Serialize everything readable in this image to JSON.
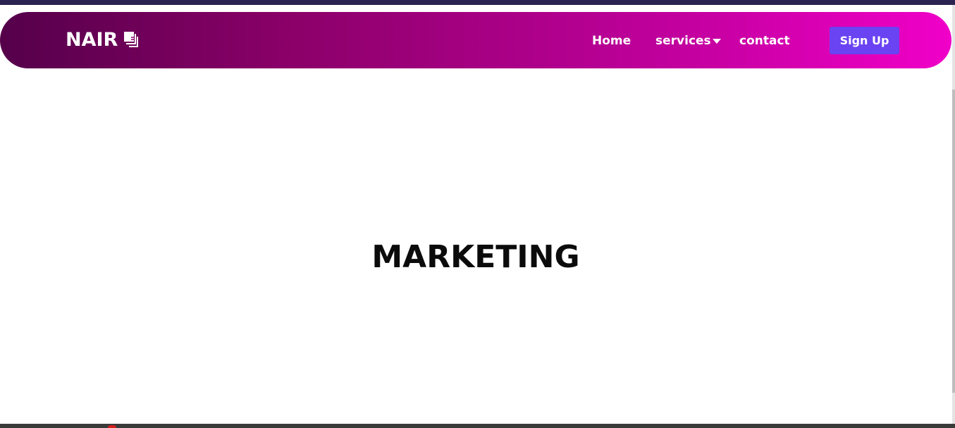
{
  "brand": {
    "name": "NAIR",
    "icon": "stacked-squares-logo-icon"
  },
  "nav": {
    "items": [
      {
        "label": "Home"
      },
      {
        "label": "services",
        "icon": "caret-down-icon"
      },
      {
        "label": "contact"
      }
    ],
    "signup_label": "Sign Up"
  },
  "hero": {
    "title": "MARKETING"
  },
  "colors": {
    "navbar_gradient_start": "#55004a",
    "navbar_gradient_end": "#f000c8",
    "signup_button": "#6a43f2",
    "text_primary": "#0b0b0b"
  }
}
